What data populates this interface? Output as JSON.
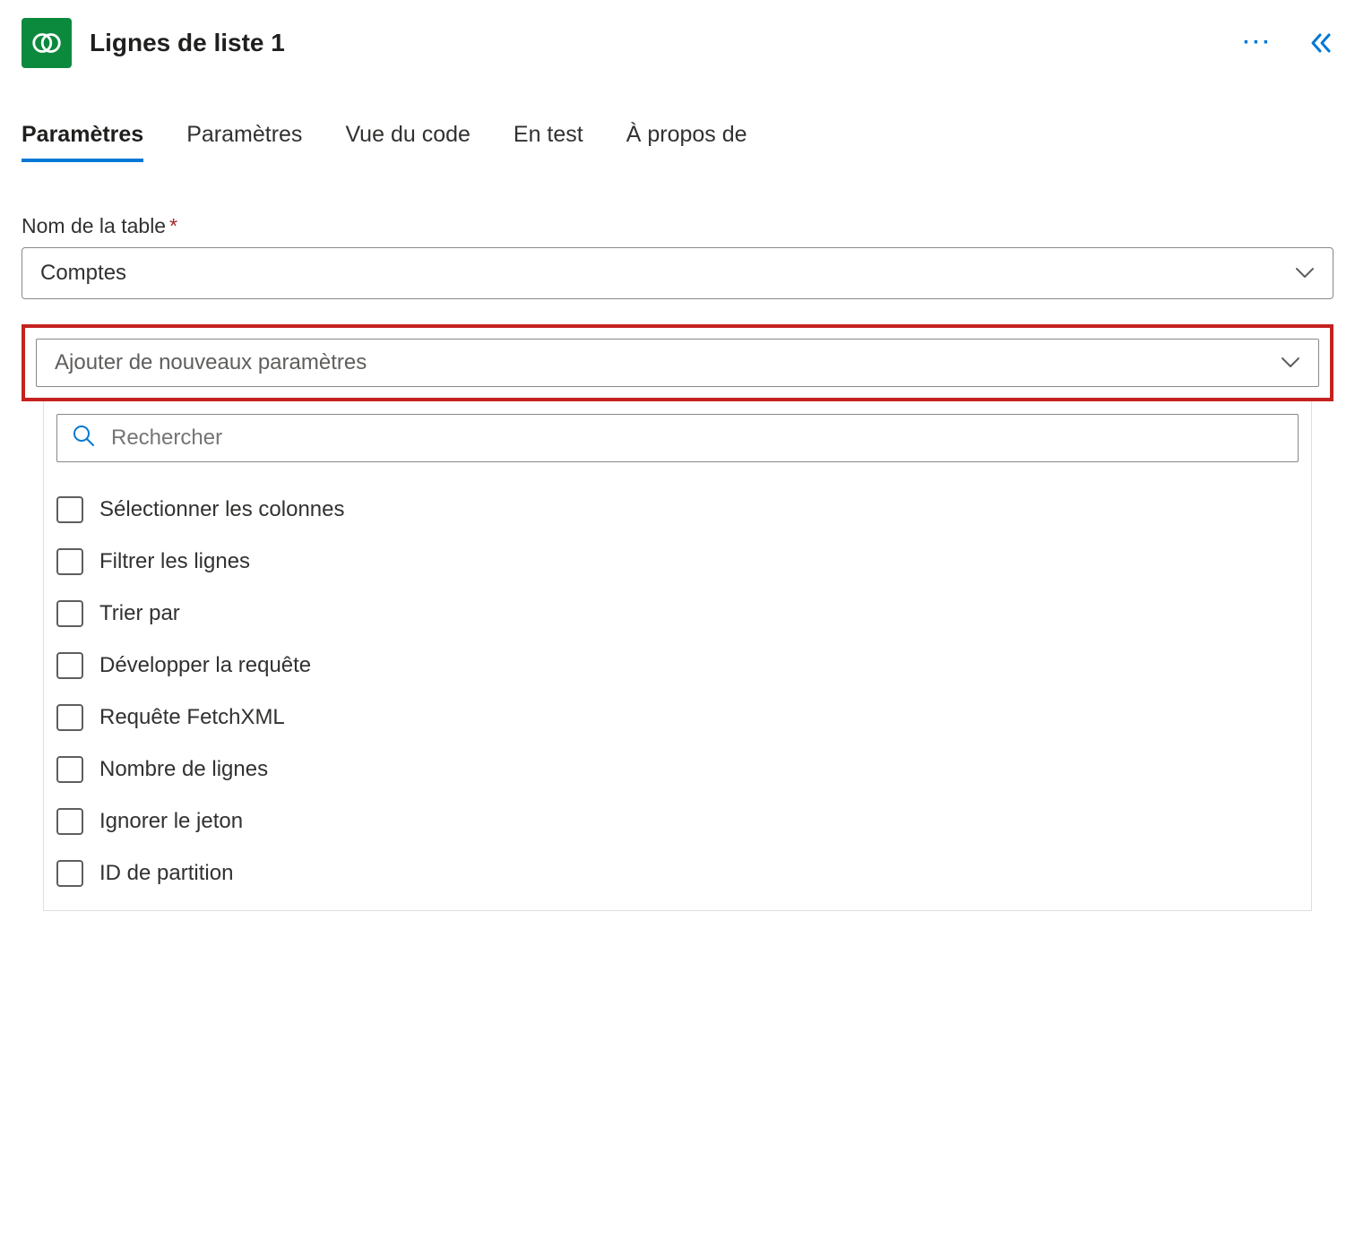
{
  "header": {
    "title": "Lignes de liste 1"
  },
  "tabs": [
    {
      "label": "Paramètres",
      "active": true
    },
    {
      "label": "Paramètres",
      "active": false
    },
    {
      "label": "Vue du code",
      "active": false
    },
    {
      "label": "En test",
      "active": false
    },
    {
      "label": "À propos de",
      "active": false
    }
  ],
  "field": {
    "table_name_label": "Nom de la table",
    "table_name_value": "Comptes"
  },
  "add_params": {
    "placeholder": "Ajouter de nouveaux paramètres",
    "search_placeholder": "Rechercher",
    "options": [
      {
        "label": "Sélectionner les colonnes"
      },
      {
        "label": "Filtrer les lignes"
      },
      {
        "label": "Trier par"
      },
      {
        "label": "Développer la requête"
      },
      {
        "label": "Requête FetchXML"
      },
      {
        "label": "Nombre de lignes"
      },
      {
        "label": "Ignorer le jeton"
      },
      {
        "label": "ID de partition"
      }
    ]
  }
}
